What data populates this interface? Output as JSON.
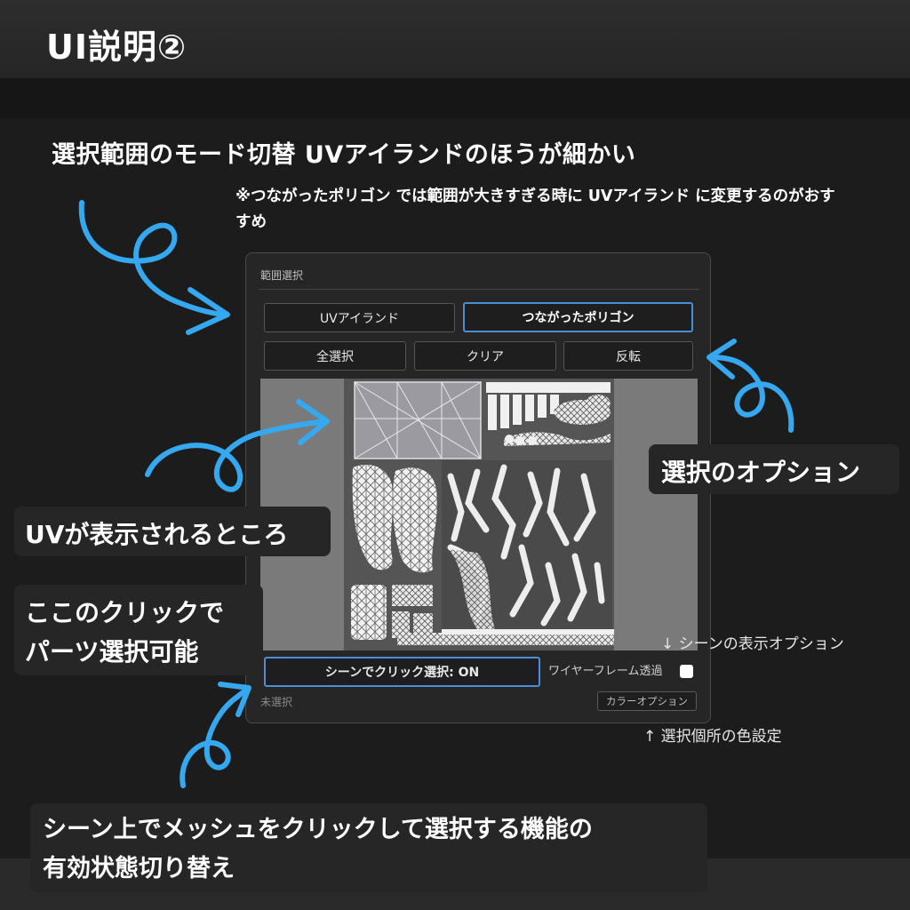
{
  "title": "UI説明②",
  "headline": "選択範囲のモード切替 UVアイランドのほうが細かい",
  "note": "※つながったポリゴン では範囲が大きすぎる時に UVアイランド に変更するのがおすすめ",
  "panel": {
    "title": "範囲選択",
    "mode_buttons": [
      "UVアイランド",
      "つながったポリゴン"
    ],
    "selected_mode": "つながったポリゴン",
    "action_buttons": [
      "全選択",
      "クリア",
      "反転"
    ],
    "scene_click_button": "シーンでクリック選択: ON",
    "wireframe_label": "ワイヤーフレーム透過",
    "wireframe_checked": false,
    "status": "未選択",
    "color_option_button": "カラーオプション"
  },
  "callouts": {
    "selection_options": "選択のオプション",
    "uv_display": "UVが表示されるところ",
    "click_select_1": "ここのクリックで",
    "click_select_2": "パーツ選択可能",
    "scene_toggle_1": "シーン上でメッシュをクリックして選択する機能の",
    "scene_toggle_2": "有効状態切り替え"
  },
  "asides": {
    "scene_display_option": "↓ シーンの表示オプション",
    "color_setting": "↑ 選択個所の色設定"
  },
  "colors": {
    "arrow": "#35a8f0",
    "active_border": "#4a8fd6"
  }
}
